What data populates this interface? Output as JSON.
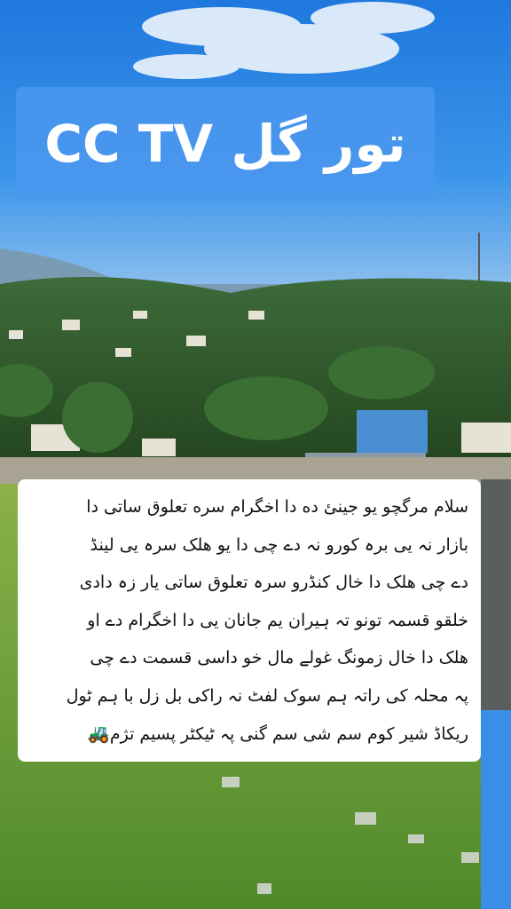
{
  "photo": {
    "subject": "hillside town with terraced slopes under blue sky, grassy foreground",
    "colors": {
      "sky": "#2f86e0",
      "cloud": "#eaf3fb",
      "hills": "#2d5a2a",
      "grass": "#6aa03a"
    }
  },
  "title": {
    "text": "تور گل CC TV"
  },
  "caption": {
    "lines": [
      "سلام مرگچو یو جینئ ده دا اخگرام سره تعلوق ساتی دا",
      "بازار نہ یی برہ کورو نہ دے چی دا یو ھلک سرہ یی لینڈ",
      "دے چی ھلک دا خال کنڈرو سرہ تعلوق ساتی یار زہ دادی",
      "خلقو قسمہ تونو تہ ہیران یم جانان یی دا اخگرام دے او",
      "ھلک دا خال زمونگ غولے مال خو داسی قسمت دے چی",
      "پہ محلہ کی راتہ ہم سوک لفٹ نہ راکی بل زل با ہم ٹول",
      "ریکاڈ شیر کوم سم شی سم گنی پہ ٹیکٹر پسیم تژم"
    ],
    "emoji": "🚜"
  }
}
